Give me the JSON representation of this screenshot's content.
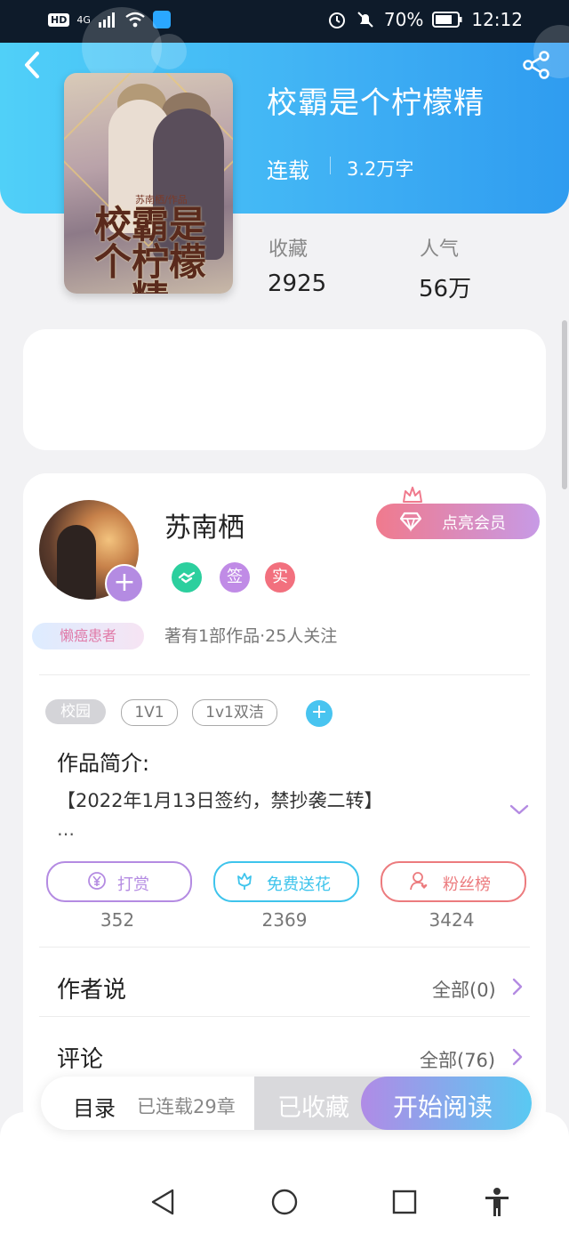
{
  "status_bar": {
    "hd": "HD",
    "signal": "4G",
    "battery": "70%",
    "time": "12:12"
  },
  "book": {
    "title": "校霸是个柠檬精",
    "status": "连载",
    "word_count": "3.2万字",
    "cover_subtitle": "苏南栖/作品",
    "cover_title": "校霸是个柠檬精",
    "stats": [
      {
        "label": "收藏",
        "value": "2925"
      },
      {
        "label": "人气",
        "value": "56万"
      }
    ]
  },
  "author": {
    "name": "苏南栖",
    "badge_lazy": "懒癌患者",
    "badges": [
      {
        "icon": "handshake-icon",
        "text": "",
        "color": "#2ccf9e"
      },
      {
        "icon": "sign-icon",
        "text": "签",
        "color": "#c08be6"
      },
      {
        "icon": "real-name-icon",
        "text": "实",
        "color": "#f2707e"
      }
    ],
    "meta": "著有1部作品·25人关注",
    "vip_label": "点亮会员"
  },
  "tags": [
    "校园",
    "1V1",
    "1v1双洁"
  ],
  "intro": {
    "label": "作品简介:",
    "text": "【2022年1月13日签约，禁抄袭二转】",
    "ellipsis": "…"
  },
  "actions": [
    {
      "label": "打赏",
      "count": "352",
      "color": "#b48be2",
      "icon": "yen-icon"
    },
    {
      "label": "免费送花",
      "count": "2369",
      "color": "#3ec4ec",
      "icon": "flower-icon"
    },
    {
      "label": "粉丝榜",
      "count": "3424",
      "color": "#ec7b7e",
      "icon": "fans-icon"
    }
  ],
  "sections": [
    {
      "title": "作者说",
      "link": "全部(0)"
    },
    {
      "title": "评论",
      "link": "全部(76)"
    }
  ],
  "reader_bar": {
    "toc": "目录",
    "chapters": "已连载29章",
    "collected": "已收藏",
    "read": "开始阅读"
  }
}
